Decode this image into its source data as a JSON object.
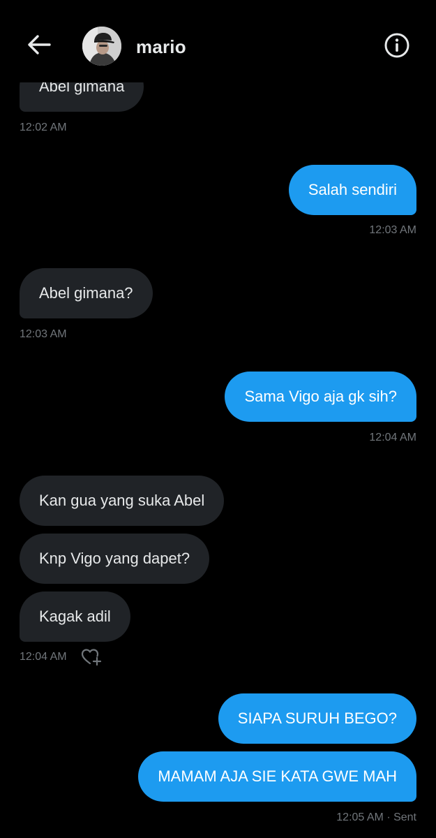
{
  "header": {
    "username": "mario",
    "back_icon": "arrow-left-icon",
    "info_icon": "info-circle-icon"
  },
  "messages": [
    {
      "direction": "in",
      "text": "Abel gimana"
    },
    {
      "direction": "out",
      "text": "Salah sendiri"
    },
    {
      "direction": "in",
      "text": "Abel gimana?"
    },
    {
      "direction": "out",
      "text": "Sama Vigo aja gk sih?"
    },
    {
      "direction": "in",
      "text": "Kan gua yang suka Abel"
    },
    {
      "direction": "in",
      "text": "Knp Vigo yang dapet?"
    },
    {
      "direction": "in",
      "text": "Kagak adil"
    },
    {
      "direction": "out",
      "text": "SIAPA SURUH BEGO?"
    },
    {
      "direction": "out",
      "text": "MAMAM AJA SIE KATA GWE MAH"
    }
  ],
  "timestamps": {
    "t1": "12:02 AM",
    "t2": "12:03 AM",
    "t3": "12:03 AM",
    "t4": "12:04 AM",
    "t5": "12:04 AM",
    "t6": "12:05 AM · Sent"
  },
  "reaction_icon": "heart-add-icon",
  "colors": {
    "background": "#000000",
    "incoming_bubble": "#202327",
    "outgoing_bubble": "#1d9bf0",
    "timestamp": "#71767b",
    "text": "#e7e9ea"
  }
}
